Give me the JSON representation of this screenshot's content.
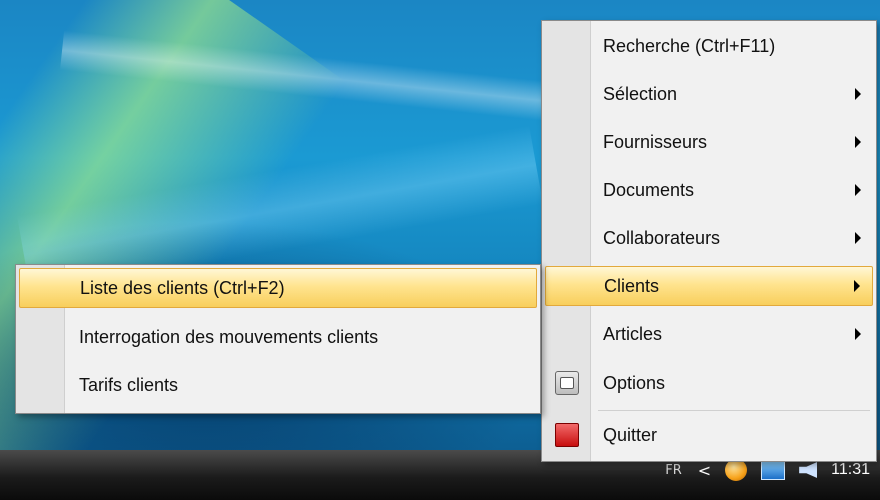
{
  "taskbar": {
    "language": "FR",
    "chevron": "<",
    "clock": "11:31",
    "icons": [
      "app-tray-icon",
      "network-icon",
      "volume-icon"
    ]
  },
  "main_menu": {
    "items": [
      {
        "label": "Recherche (Ctrl+F11)",
        "submenu": false
      },
      {
        "label": "Sélection",
        "submenu": true
      },
      {
        "label": "Fournisseurs",
        "submenu": true
      },
      {
        "label": "Documents",
        "submenu": true
      },
      {
        "label": "Collaborateurs",
        "submenu": true
      },
      {
        "label": "Clients",
        "submenu": true,
        "highlighted": true
      },
      {
        "label": "Articles",
        "submenu": true
      },
      {
        "label": "Options",
        "submenu": false,
        "icon": "options-icon"
      },
      {
        "label": "Quitter",
        "submenu": false,
        "icon": "quit-icon"
      }
    ]
  },
  "clients_submenu": {
    "items": [
      {
        "label": "Liste des clients (Ctrl+F2)",
        "highlighted": true
      },
      {
        "label": "Interrogation des mouvements clients"
      },
      {
        "label": "Tarifs clients"
      }
    ]
  }
}
